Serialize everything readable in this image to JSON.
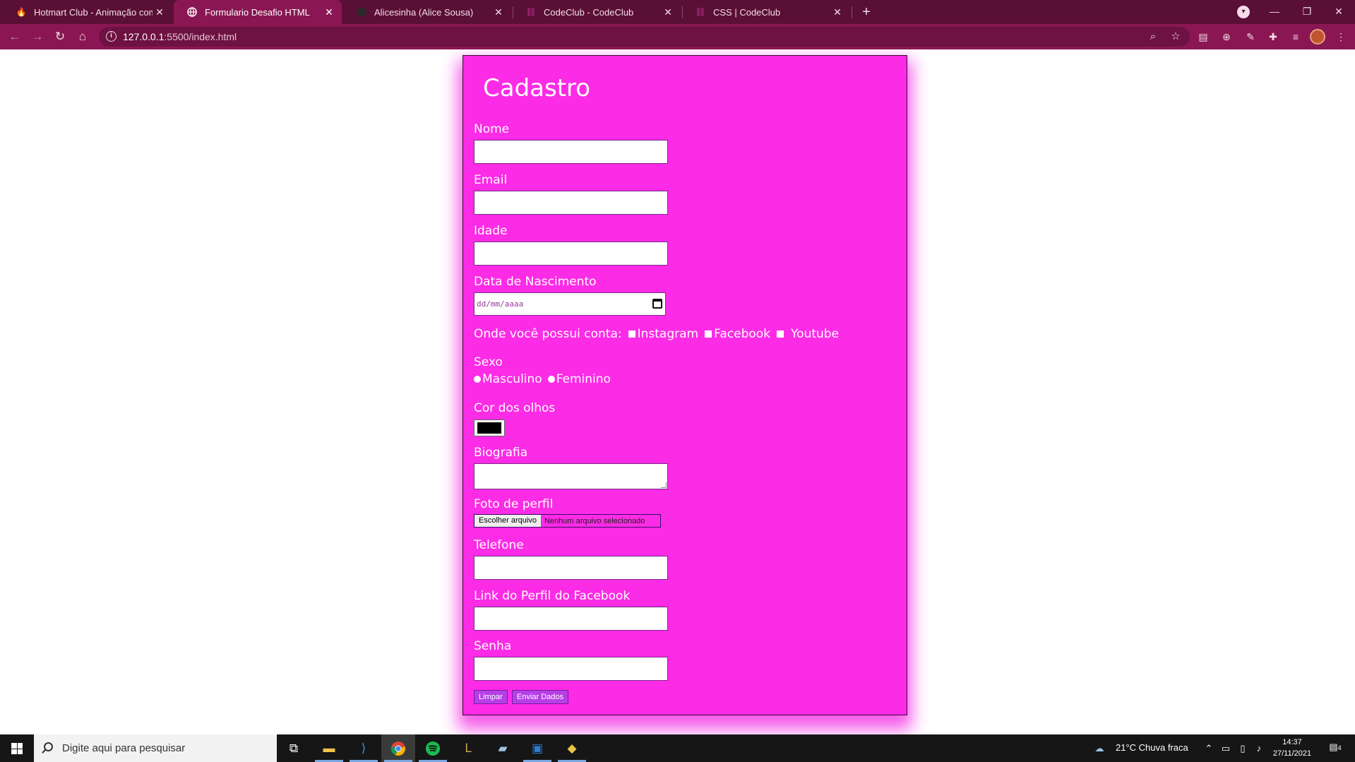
{
  "browser": {
    "tabs": [
      {
        "title": "Hotmart Club - Animação com H",
        "icon": "fire-icon",
        "active": false
      },
      {
        "title": "Formulario Desafio HTML",
        "icon": "globe-icon",
        "active": true
      },
      {
        "title": "Alicesinha (Alice Sousa)",
        "icon": "github-icon",
        "active": false
      },
      {
        "title": "CodeClub - CodeClub",
        "icon": "codeclub-icon",
        "active": false
      },
      {
        "title": "CSS | CodeClub",
        "icon": "codeclub-icon",
        "active": false
      }
    ],
    "close_glyph": "✕",
    "new_tab_glyph": "+",
    "url_host": "127.0.0.1",
    "url_path": ":5500/index.html",
    "window_controls": {
      "minimize": "—",
      "restore": "❐",
      "close": "✕"
    },
    "colors": {
      "frame": "#5a0f36",
      "toolbar": "#8a1753"
    }
  },
  "form": {
    "title": "Cadastro",
    "background": "#fc2be6",
    "labels": {
      "nome": "Nome",
      "email": "Email",
      "idade": "Idade",
      "nascimento": "Data de Nascimento",
      "contas": "Onde você possui conta:",
      "sexo": "Sexo",
      "olhos": "Cor dos olhos",
      "bio": "Biografia",
      "foto": "Foto de perfil",
      "telefone": "Telefone",
      "facebook_link": "Link do Perfil do Facebook",
      "senha": "Senha"
    },
    "date_placeholder": "dd/mm/aaaa",
    "accounts": [
      "Instagram",
      "Facebook",
      "Youtube"
    ],
    "sexo_options": [
      "Masculino",
      "Feminino"
    ],
    "eye_color": "#000000",
    "file_button": "Escolher arquivo",
    "file_status": "Nenhum arquivo selecionado",
    "buttons": {
      "reset": "Limpar",
      "submit": "Enviar Dados"
    }
  },
  "taskbar": {
    "search_placeholder": "Digite aqui para pesquisar",
    "weather": "21°C  Chuva fraca",
    "time": "14:37",
    "date": "27/11/2021",
    "notification_count": "4"
  }
}
